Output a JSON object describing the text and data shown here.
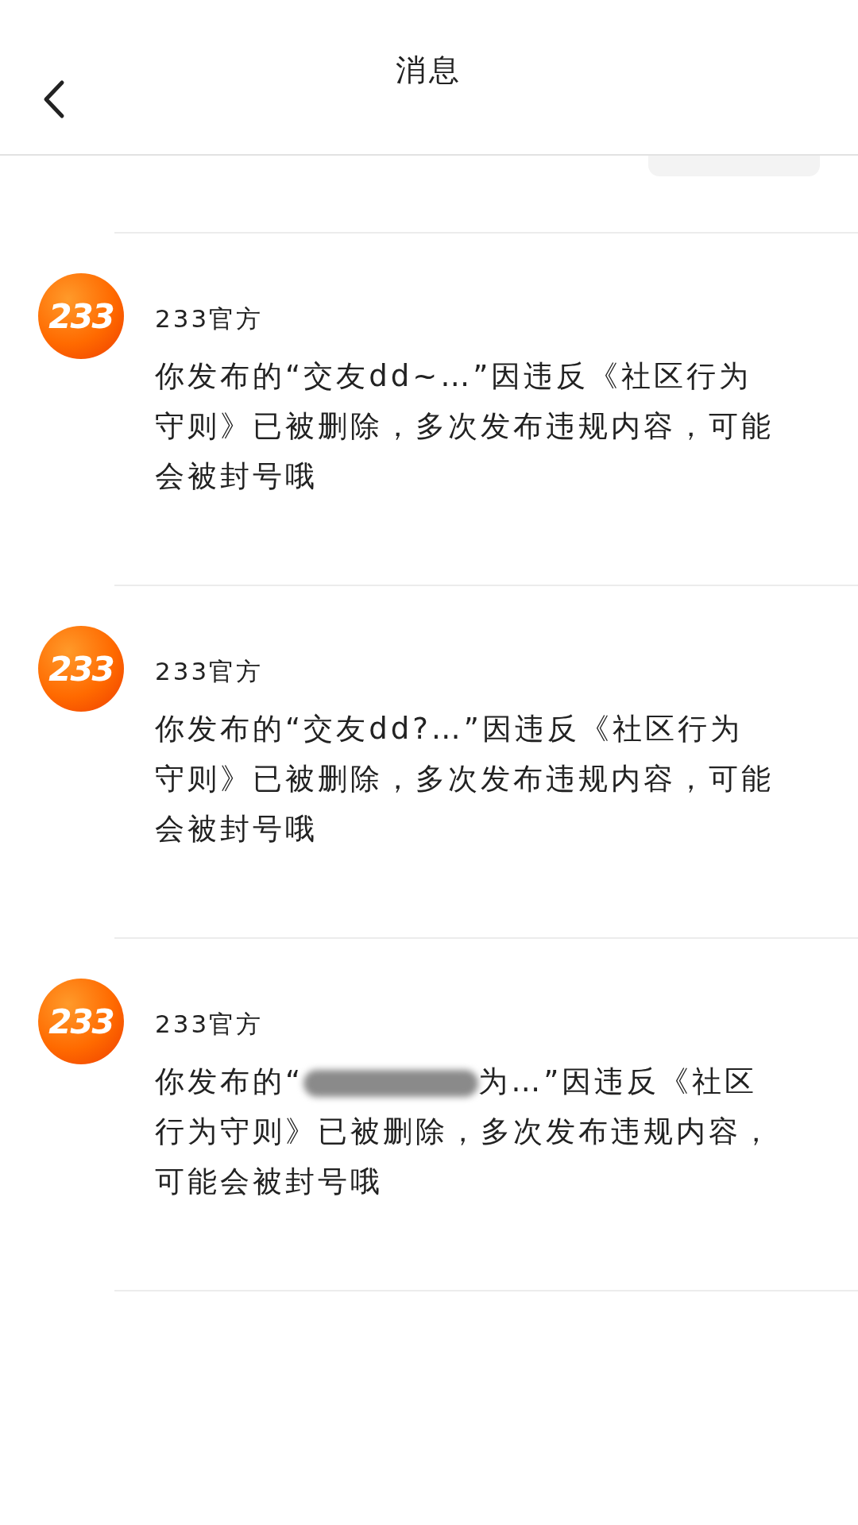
{
  "header": {
    "title": "消息"
  },
  "messages": [
    {
      "avatar_text": "233",
      "sender": "233官方",
      "kind": "plain",
      "text": "你发布的“交友dd~…”因违反《社区行为守则》已被删除，多次发布违规内容，可能会被封号哦"
    },
    {
      "avatar_text": "233",
      "sender": "233官方",
      "kind": "plain",
      "text": "你发布的“交友dd?…”因违反《社区行为守则》已被删除，多次发布违规内容，可能会被封号哦"
    },
    {
      "avatar_text": "233",
      "sender": "233官方",
      "kind": "redacted",
      "text_before": "你发布的“",
      "text_after": "为…”因违反《社区行为守则》已被删除，多次发布违规内容，可能会被封号哦"
    }
  ]
}
